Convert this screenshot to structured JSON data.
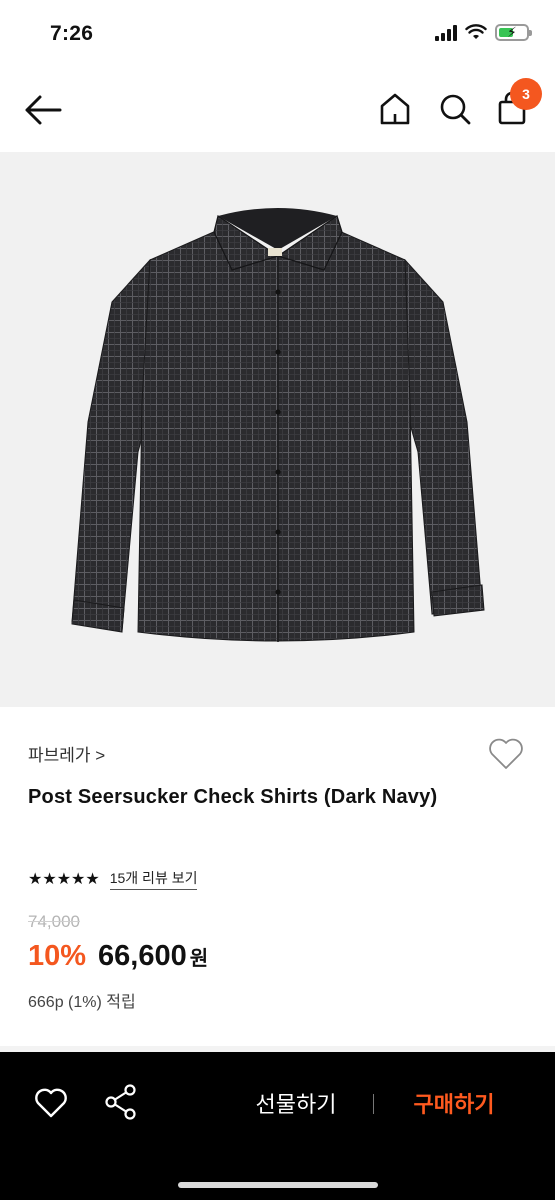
{
  "status_bar": {
    "time": "7:26"
  },
  "header": {
    "cart_count": "3"
  },
  "product": {
    "brand": "파브레가 >",
    "name": "Post Seersucker Check Shirts (Dark Navy)",
    "stars": "★★★★★",
    "review_link": "15개 리뷰 보기",
    "original_price": "74,000",
    "discount": "10%",
    "sale_price": "66,600",
    "currency": "원",
    "points": "666p (1%) 적립"
  },
  "bottom_bar": {
    "gift_label": "선물하기",
    "buy_label": "구매하기"
  },
  "colors": {
    "accent": "#f4571f",
    "bottom_bar": "#000000",
    "image_bg": "#f1f1f1"
  },
  "icons": [
    "back-arrow-icon",
    "home-icon",
    "search-icon",
    "cart-icon",
    "heart-icon",
    "share-icon"
  ]
}
